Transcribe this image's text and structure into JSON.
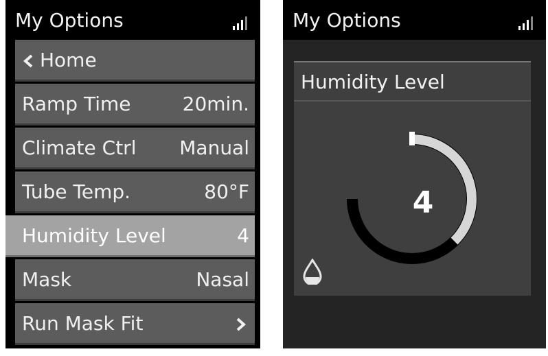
{
  "left_screen": {
    "title": "My Options",
    "signal_icon": "signal-bars-icon",
    "menu": [
      {
        "label": "Home",
        "value": "",
        "icon_left": "chevron-left-icon"
      },
      {
        "label": "Ramp Time",
        "value": "20min."
      },
      {
        "label": "Climate Ctrl",
        "value": "Manual"
      },
      {
        "label": "Tube Temp.",
        "value": "80°F"
      },
      {
        "label": "Humidity Level",
        "value": "4",
        "selected": true
      },
      {
        "label": "Mask",
        "value": "Nasal"
      },
      {
        "label": "Run Mask Fit",
        "value": "",
        "icon_right": "chevron-right-icon"
      }
    ]
  },
  "right_screen": {
    "title": "My Options",
    "signal_icon": "signal-bars-icon",
    "panel_title": "Humidity Level",
    "level": "4",
    "level_fraction": 0.5,
    "drop_icon": "water-drop-icon",
    "colors": {
      "background": "#242424",
      "panel": "#3f3f3f",
      "track": "#000000",
      "fill": "#d6d6d6",
      "selected_row": "#a3a3a3"
    }
  }
}
